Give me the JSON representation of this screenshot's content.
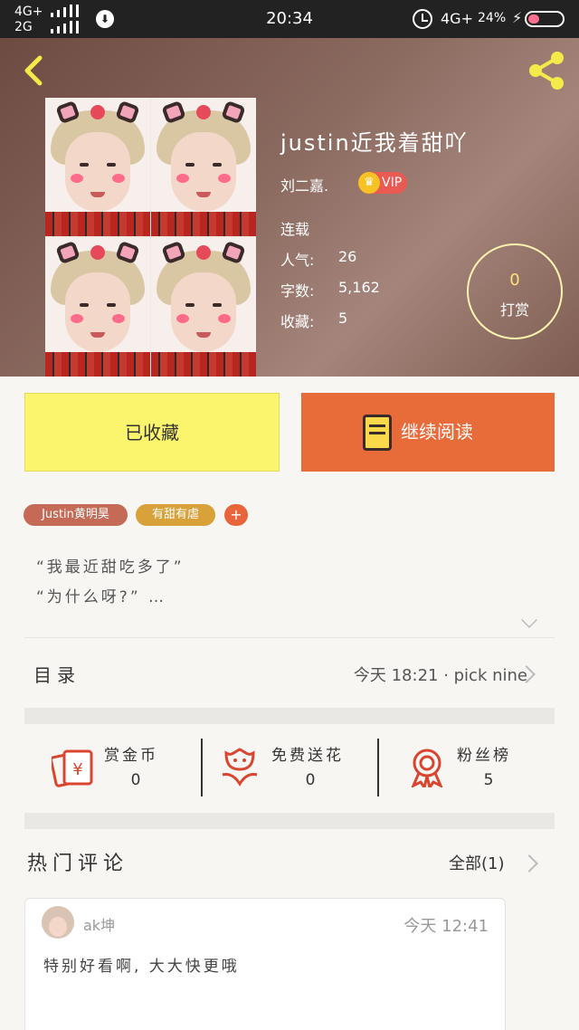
{
  "status_bar": {
    "network_top": "4G+",
    "network_bottom": "2G",
    "time": "20:34",
    "network_right": "4G+",
    "battery": "24%"
  },
  "book": {
    "title": "justin近我着甜吖",
    "author": "刘二嘉.",
    "vip_label": "VIP",
    "status": "连载",
    "stats": [
      {
        "label": "人气:",
        "value": "26"
      },
      {
        "label": "字数:",
        "value": "5,162"
      },
      {
        "label": "收藏:",
        "value": "5"
      }
    ],
    "tip": {
      "count": "0",
      "label": "打赏"
    }
  },
  "actions": {
    "collected_label": "已收藏",
    "continue_label": "继续阅读"
  },
  "tags": [
    "Justin黄明昊",
    "有甜有虐",
    "+"
  ],
  "intro": [
    "“我最近甜吃多了”",
    "“为什么呀?” …"
  ],
  "toc": {
    "label": "目录",
    "update": "今天 18:21 · pick nine"
  },
  "support": [
    {
      "label": "赏金币",
      "value": "0",
      "icon": "red-envelope-icon"
    },
    {
      "label": "免费送花",
      "value": "0",
      "icon": "flower-icon"
    },
    {
      "label": "粉丝榜",
      "value": "5",
      "icon": "medal-icon"
    }
  ],
  "comments": {
    "title": "热门评论",
    "all_label": "全部(1)",
    "items": [
      {
        "user": "ak坤",
        "time": "今天 12:41",
        "text": "特别好看啊, 大大快更哦"
      }
    ]
  },
  "colors": {
    "collect_bg": "#fbf56e",
    "read_bg": "#e86b3a",
    "accent_red": "#d9452f"
  }
}
